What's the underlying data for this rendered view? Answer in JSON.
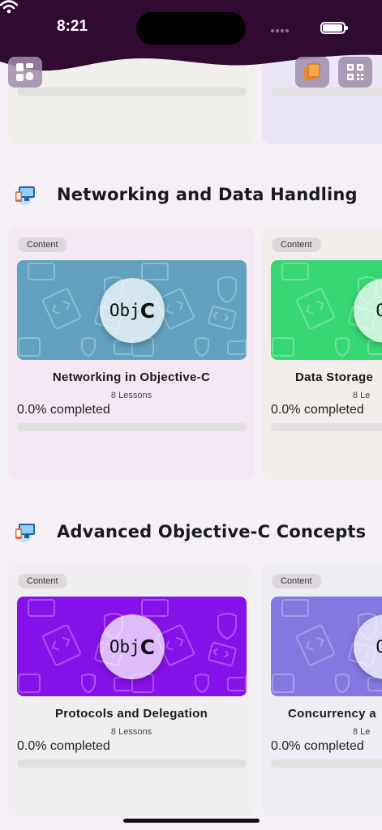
{
  "status": {
    "time": "8:21"
  },
  "colors": {
    "header": "#310a32",
    "networking_banner": "#62a1bf",
    "storage_banner": "#36d673",
    "protocols_banner": "#8711ea",
    "concurrency_banner": "#8477e0"
  },
  "header": {
    "left_icon": "dashboard-grid-icon",
    "right_icons": [
      "book-stack-icon",
      "qr-code-icon"
    ]
  },
  "sections": [
    {
      "title": "Networking and Data Handling",
      "icon": "computer-devices-icon",
      "cards": [
        {
          "badge": "Content",
          "logo_text": "Obj",
          "logo_bold": "C",
          "title": "Networking in Objective-C",
          "lessons": "8 Lessons",
          "completed": "0.0% completed",
          "progress": 0
        },
        {
          "badge": "Content",
          "logo_text": "Ol",
          "title": "Data Storage",
          "lessons": "8 Le",
          "completed": "0.0% completed",
          "progress": 0
        }
      ]
    },
    {
      "title": "Advanced Objective-C Concepts",
      "icon": "computer-devices-icon",
      "cards": [
        {
          "badge": "Content",
          "logo_text": "Obj",
          "logo_bold": "C",
          "title": "Protocols and Delegation",
          "lessons": "8 Lessons",
          "completed": "0.0% completed",
          "progress": 0
        },
        {
          "badge": "Content",
          "logo_text": "Ol",
          "title": "Concurrency a",
          "lessons": "8 Le",
          "completed": "0.0% completed",
          "progress": 0
        }
      ]
    }
  ]
}
